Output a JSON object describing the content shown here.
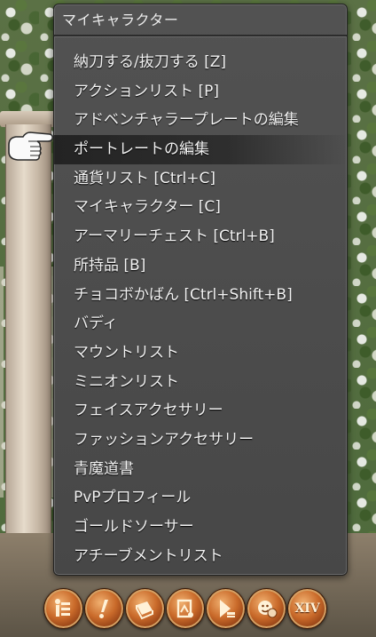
{
  "menu": {
    "title": "マイキャラクター",
    "items": [
      {
        "label": "納刀する/抜刀する [Z]"
      },
      {
        "label": "アクションリスト [P]"
      },
      {
        "label": "アドベンチャラープレートの編集"
      },
      {
        "label": "ポートレートの編集",
        "highlighted": true
      },
      {
        "label": "通貨リスト [Ctrl+C]"
      },
      {
        "label": "マイキャラクター [C]"
      },
      {
        "label": "アーマリーチェスト [Ctrl+B]"
      },
      {
        "label": "所持品 [B]"
      },
      {
        "label": "チョコボかばん [Ctrl+Shift+B]"
      },
      {
        "label": "バディ"
      },
      {
        "label": "マウントリスト"
      },
      {
        "label": "ミニオンリスト"
      },
      {
        "label": "フェイスアクセサリー"
      },
      {
        "label": "ファッションアクセサリー"
      },
      {
        "label": "青魔道書"
      },
      {
        "label": "PvPプロフィール"
      },
      {
        "label": "ゴールドソーサー"
      },
      {
        "label": "アチーブメントリスト"
      }
    ]
  },
  "hotbar": {
    "buttons": [
      {
        "icon": "character-icon"
      },
      {
        "icon": "duty-icon"
      },
      {
        "icon": "logs-icon"
      },
      {
        "icon": "travel-icon"
      },
      {
        "icon": "party-icon"
      },
      {
        "icon": "social-icon"
      },
      {
        "icon": "system-icon",
        "text": "XIV"
      }
    ]
  },
  "colors": {
    "menu_bg": "#4d4d4d",
    "menu_text": "#f2f2f2",
    "hotbar_accent": "#c96a2a"
  }
}
